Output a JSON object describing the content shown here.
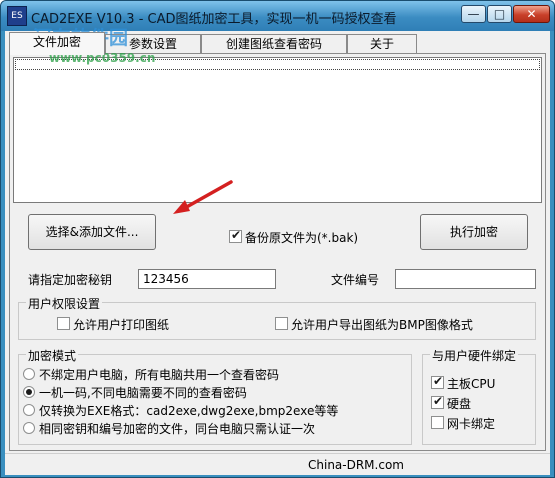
{
  "window": {
    "title": "CAD2EXE V10.3 - CAD图纸加密工具，实现一机一码授权查看",
    "app_icon_text": "ES",
    "minimize": "—",
    "maximize": "□",
    "close": "✕"
  },
  "watermark": {
    "line1": "河东软件园",
    "line2": "www.pc0359.cn"
  },
  "tabs": [
    {
      "label": "文件加密"
    },
    {
      "label": "参数设置"
    },
    {
      "label": "创建图纸查看密码"
    },
    {
      "label": "关于"
    }
  ],
  "actions": {
    "select_add_files": "选择&添加文件...",
    "backup_label": "备份原文件为(*.bak)",
    "backup_checked": true,
    "execute": "执行加密"
  },
  "key": {
    "label": "请指定加密秘钥",
    "value": "123456"
  },
  "file_no": {
    "label": "文件编号",
    "value": ""
  },
  "permissions": {
    "title": "用户权限设置",
    "allow_print": "允许用户打印图纸",
    "allow_export": "允许用户导出图纸为BMP图像格式"
  },
  "mode": {
    "title": "加密模式",
    "options": [
      "不绑定用户电脑，所有电脑共用一个查看密码",
      "一机一码,不同电脑需要不同的查看密码",
      "仅转换为EXE格式：cad2exe,dwg2exe,bmp2exe等等",
      "相同密钥和编号加密的文件，同台电脑只需认证一次"
    ],
    "selected": "一机一码,不同电脑需要不同的查看密码"
  },
  "hardware": {
    "title": "与用户硬件绑定",
    "items": [
      {
        "label": "主板CPU",
        "checked": true
      },
      {
        "label": "硬盘",
        "checked": true
      },
      {
        "label": "网卡绑定",
        "checked": false
      }
    ]
  },
  "status_bar": {
    "text": "China-DRM.com"
  },
  "colors": {
    "titlebar": "#3b8cc2",
    "arrow": "#d42020",
    "watermark": "#2d8fd8"
  }
}
